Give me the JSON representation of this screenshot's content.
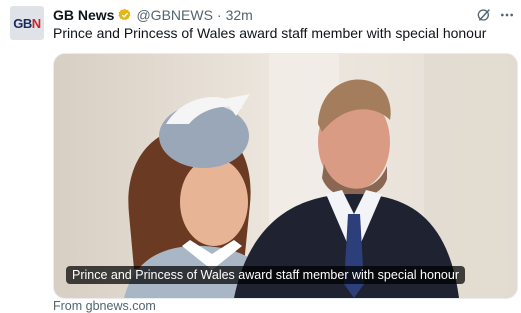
{
  "account": {
    "avatar_text_main": "GB",
    "avatar_text_accent": "N",
    "display_name": "GB News",
    "handle": "@GBNEWS",
    "separator": "·",
    "time": "32m"
  },
  "post": {
    "text": "Prince and Princess of Wales award staff member with special honour"
  },
  "card": {
    "caption": "Prince and Princess of Wales award staff member with special honour",
    "source": "From gbnews.com"
  },
  "icons": {
    "grok": "grok-icon",
    "more": "more-icon",
    "verified": "verified-badge-icon"
  },
  "colors": {
    "verified_gold": "#e2b719",
    "text_secondary": "#536471",
    "brand_navy": "#1b2a5e",
    "brand_red": "#d3202a"
  }
}
